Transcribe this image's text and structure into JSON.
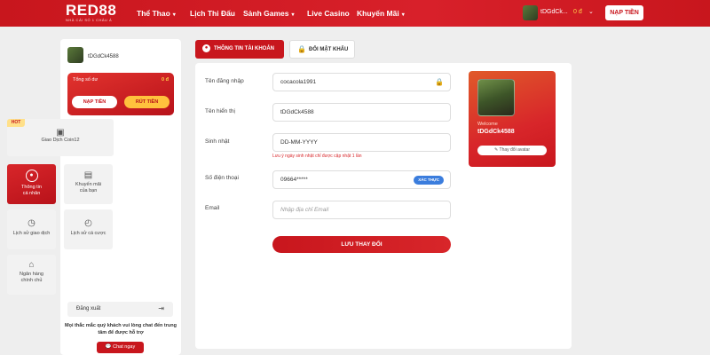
{
  "header": {
    "logo": "RED88",
    "logo_tagline": "NHÀ CÁI SỐ 1 CHÂU Á",
    "nav": [
      {
        "label": "Thể Thao",
        "has_dropdown": true
      },
      {
        "label": "Lịch Thi Đấu",
        "has_dropdown": false
      },
      {
        "label": "Sảnh Games",
        "has_dropdown": true
      },
      {
        "label": "Live Casino",
        "has_dropdown": false
      },
      {
        "label": "Khuyến Mãi",
        "has_dropdown": true
      }
    ],
    "username": "tDGdCk...",
    "balance": "0 đ",
    "deposit_label": "NẠP TIỀN",
    "brand_color": "#c8161d"
  },
  "sidebar": {
    "username": "tDGdCk4588",
    "balance_label": "Tổng số dư",
    "balance_value": "0 đ",
    "deposit_label": "NẠP TIỀN",
    "withdraw_label": "RÚT TIỀN",
    "hot_badge": "HOT",
    "items": {
      "coin": {
        "label": "Giao Dịch Coin12",
        "icon": "coin-icon"
      },
      "info": {
        "label1": "Thông tin",
        "label2": "cá nhân",
        "icon": "user-icon"
      },
      "promo": {
        "label1": "Khuyến mãi",
        "label2": "của bạn",
        "icon": "gift-icon"
      },
      "transactions": {
        "label": "Lịch sử giao dịch",
        "icon": "history-icon"
      },
      "bets": {
        "label": "Lịch sử cá cược",
        "icon": "bet-history-icon"
      },
      "bank": {
        "label1": "Ngân hàng",
        "label2": "chính chủ",
        "icon": "bank-icon"
      }
    },
    "logout_label": "Đăng xuất",
    "help_text": "Mọi thắc mắc quý khách vui lòng chat đến trung tâm để được hỗ trợ",
    "chat_label": "Chat ngay"
  },
  "tabs": [
    {
      "label": "THÔNG TIN TÀI KHOẢN",
      "active": true
    },
    {
      "label": "ĐỔI MẬT KHẨU",
      "active": false
    }
  ],
  "form": {
    "login_label": "Tên đăng nhập",
    "login_value": "cocacola1991",
    "display_label": "Tên hiển thị",
    "display_value": "tDGdCk4588",
    "birthday_label": "Sinh nhật",
    "birthday_value": "DD-MM-YYYY",
    "birthday_hint": "Lưu ý ngày sinh nhật chỉ được cập nhật 1 lần",
    "phone_label": "Số điện thoại",
    "phone_value": "09664*****",
    "verify_label": "XÁC THỰC",
    "email_label": "Email",
    "email_placeholder": "Nhập địa chỉ Email",
    "save_label": "LƯU THAY ĐỔI"
  },
  "profile": {
    "welcome": "Welcome",
    "username": "tDGdCk4588",
    "change_avatar_label": "Thay đổi avatar"
  }
}
